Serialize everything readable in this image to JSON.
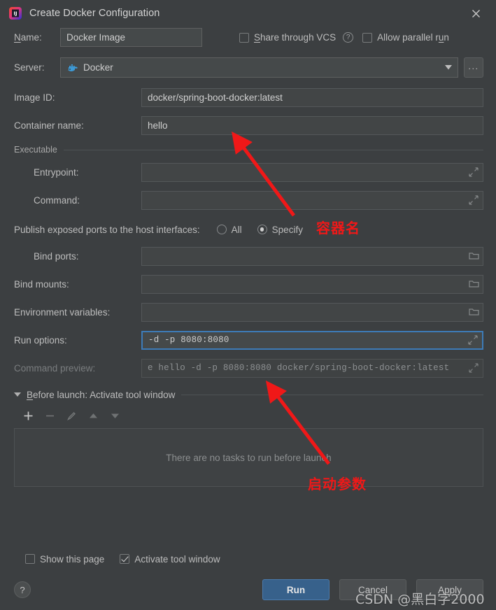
{
  "window": {
    "title": "Create Docker Configuration",
    "app_icon": "intellij-idea-icon",
    "close_icon": "close-icon"
  },
  "form": {
    "name": {
      "label": "Name:",
      "value": "Docker Image",
      "placeholder": ""
    },
    "share_vcs": {
      "label": "Share through VCS",
      "checked": false,
      "help_icon": "question-mark-icon"
    },
    "allow_parallel_run": {
      "label": "Allow parallel run",
      "checked": false
    },
    "server": {
      "label": "Server:",
      "value": "Docker",
      "icon": "docker-whale-icon",
      "dropdown_icon": "chevron-down-icon",
      "browse_label": "..."
    },
    "image_id": {
      "label": "Image ID:",
      "value": "docker/spring-boot-docker:latest"
    },
    "container_name": {
      "label": "Container name:",
      "value": "hello"
    },
    "executable_section": "Executable",
    "entrypoint": {
      "label": "Entrypoint:",
      "value": "",
      "expand_icon": "expand-icon"
    },
    "command": {
      "label": "Command:",
      "value": "",
      "expand_icon": "expand-icon"
    },
    "publish_ports": {
      "label": "Publish exposed ports to the host interfaces:",
      "options": [
        "All",
        "Specify"
      ],
      "selected": "Specify"
    },
    "bind_ports": {
      "label": "Bind ports:",
      "value": "",
      "browse_icon": "folder-icon"
    },
    "bind_mounts": {
      "label": "Bind mounts:",
      "value": "",
      "browse_icon": "folder-icon"
    },
    "environment_variables": {
      "label": "Environment variables:",
      "value": "",
      "browse_icon": "folder-icon"
    },
    "run_options": {
      "label": "Run options:",
      "value": "-d -p 8080:8080",
      "expand_icon": "expand-icon",
      "focused": true
    },
    "command_preview": {
      "label": "Command preview:",
      "value": "e hello -d -p 8080:8080 docker/spring-boot-docker:latest",
      "expand_icon": "expand-icon",
      "readonly": true
    }
  },
  "before_launch": {
    "header": "Before launch: Activate tool window",
    "collapse_icon": "triangle-down-icon",
    "toolbar": [
      {
        "name": "add-task-button",
        "icon": "plus-icon",
        "enabled": true
      },
      {
        "name": "remove-task-button",
        "icon": "minus-icon",
        "enabled": false
      },
      {
        "name": "edit-task-button",
        "icon": "pencil-icon",
        "enabled": false
      },
      {
        "name": "move-up-button",
        "icon": "arrow-up-icon",
        "enabled": false
      },
      {
        "name": "move-down-button",
        "icon": "arrow-down-icon",
        "enabled": false
      }
    ],
    "empty_text": "There are no tasks to run before launch"
  },
  "footer": {
    "show_this_page": {
      "label": "Show this page",
      "checked": false
    },
    "activate_tool_window": {
      "label": "Activate tool window",
      "checked": true
    },
    "help_label": "?",
    "run_label": "Run",
    "cancel_label": "Cancel",
    "apply_label": "Apply"
  },
  "annotations": {
    "container_name_note": "容器名",
    "run_options_note": "启动参数",
    "arrow_color": "#f01818",
    "watermark": "CSDN @黑白字2000"
  }
}
